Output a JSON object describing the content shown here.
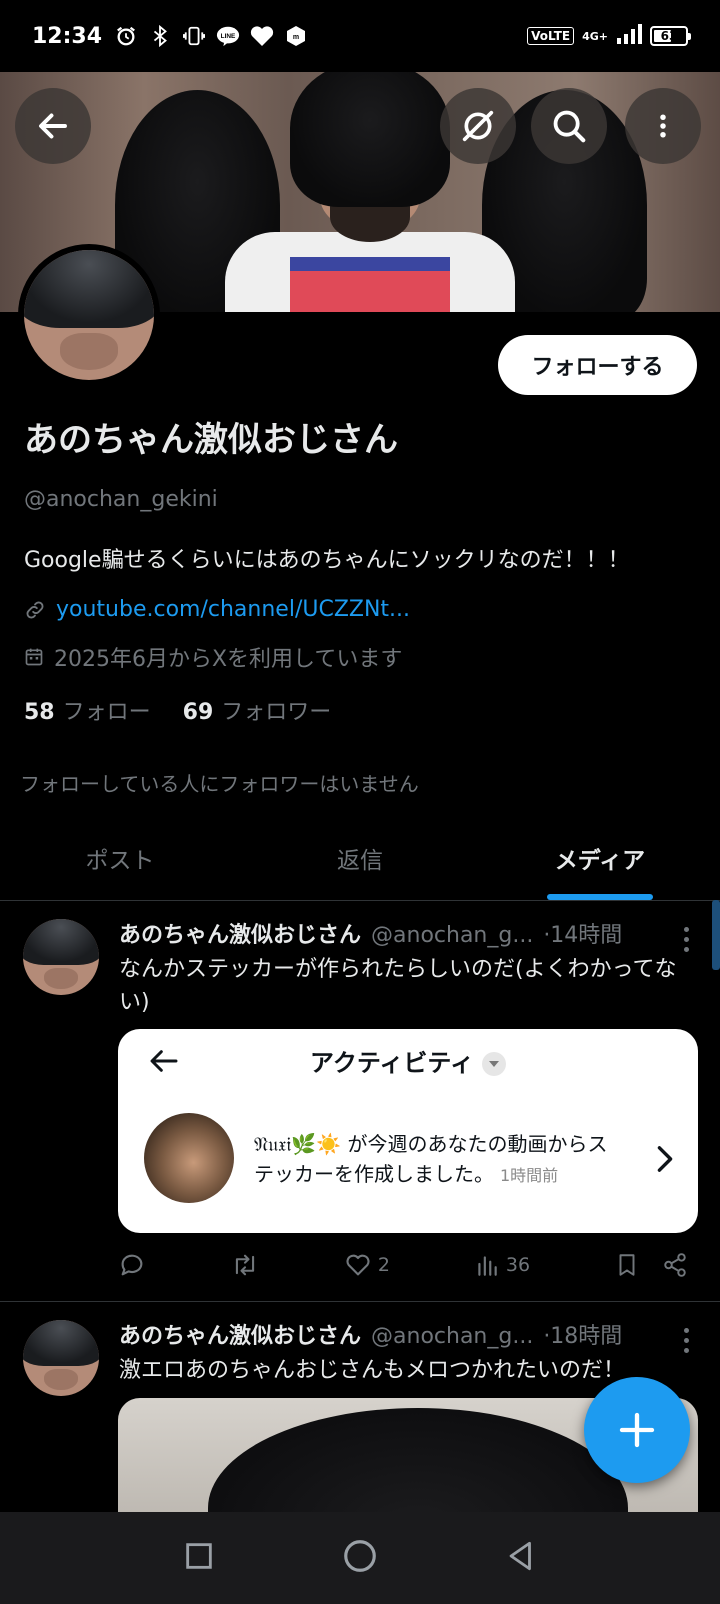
{
  "status_bar": {
    "time": "12:34",
    "volte": "VoLTE",
    "network": "4G+",
    "battery_level": "63",
    "battery_fraction": 0.63
  },
  "header": {
    "icons": [
      "back-arrow-icon",
      "grok-icon",
      "search-icon",
      "more-vertical-icon"
    ]
  },
  "profile": {
    "name": "あのちゃん激似おじさん",
    "handle": "@anochan_gekini",
    "follow_button": "フォローする",
    "bio": "Google騙せるくらいにはあのちゃんにソックリなのだ！！！",
    "link": "youtube.com/channel/UCZZNt...",
    "joined": "2025年6月からXを利用しています",
    "following_count": "58",
    "following_label": "フォロー",
    "followers_count": "69",
    "followers_label": "フォロワー",
    "mutual_note": "フォローしている人にフォロワーはいません"
  },
  "tabs": [
    {
      "label": "ポスト",
      "active": false
    },
    {
      "label": "返信",
      "active": false
    },
    {
      "label": "メディア",
      "active": true
    }
  ],
  "posts": [
    {
      "author": "あのちゃん激似おじさん",
      "handle": "@anochan_g...",
      "time": "·14時間",
      "text": "なんかステッカーが作られたらしいのだ(よくわかってない)",
      "embed": {
        "title": "アクティビティ",
        "notice_user": "𝔑𝔲𝔵𝔦🌿☀️",
        "notice_text": "が今週のあなたの動画からステッカーを作成しました。",
        "notice_time": "1時間前"
      },
      "likes": "2",
      "views": "36"
    },
    {
      "author": "あのちゃん激似おじさん",
      "handle": "@anochan_g...",
      "time": "·18時間",
      "text": "激エロあのちゃんおじさんもメロつかれたいのだ！"
    }
  ],
  "colors": {
    "accent": "#1d9bf0",
    "background": "#000000",
    "secondary_text": "#71767b"
  }
}
